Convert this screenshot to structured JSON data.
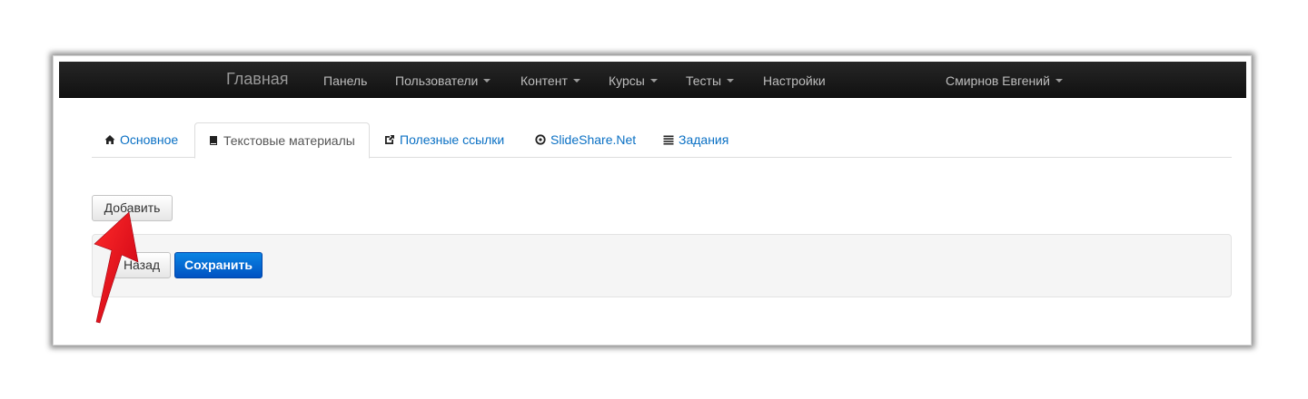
{
  "navbar": {
    "brand": "Главная",
    "items": [
      {
        "label": "Панель",
        "dropdown": false
      },
      {
        "label": "Пользователи",
        "dropdown": true
      },
      {
        "label": "Контент",
        "dropdown": true
      },
      {
        "label": "Курсы",
        "dropdown": true
      },
      {
        "label": "Тесты",
        "dropdown": true
      },
      {
        "label": "Настройки",
        "dropdown": false
      }
    ],
    "user": "Смирнов Евгений"
  },
  "tabs": [
    {
      "label": "Основное",
      "icon": "home-icon",
      "active": false
    },
    {
      "label": "Текстовые материалы",
      "icon": "book-icon",
      "active": true
    },
    {
      "label": "Полезные ссылки",
      "icon": "external-link-icon",
      "active": false
    },
    {
      "label": "SlideShare.Net",
      "icon": "play-circle-icon",
      "active": false
    },
    {
      "label": "Задания",
      "icon": "list-icon",
      "active": false
    }
  ],
  "buttons": {
    "add": "Добавить",
    "back": "Назад",
    "save": "Сохранить"
  },
  "colors": {
    "link": "#0a70c4",
    "primary": "#0066cc",
    "annotation_arrow": "#e0001a",
    "navbar": "#1b1b1b"
  }
}
